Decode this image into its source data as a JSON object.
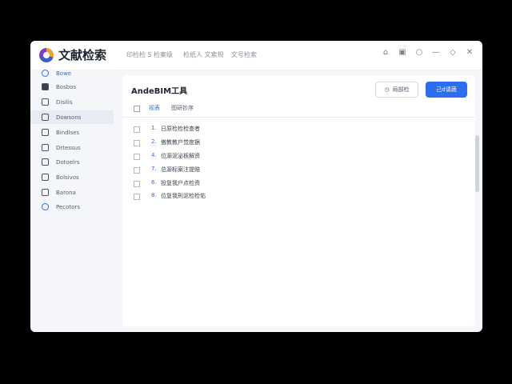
{
  "app": {
    "title": "文献检索"
  },
  "topnav": [
    "印检检 5",
    "检案级",
    "检纸人 文索规",
    "文号检索"
  ],
  "sidebar": {
    "items": [
      {
        "label": "Bowe",
        "icon": "globe-icon"
      },
      {
        "label": "Bosbos",
        "icon": "image-icon"
      },
      {
        "label": "Disilis",
        "icon": "doc-icon"
      },
      {
        "label": "Dowsons",
        "icon": "file-icon"
      },
      {
        "label": "Bindlses",
        "icon": "book-icon"
      },
      {
        "label": "Drtessus",
        "icon": "folder-icon"
      },
      {
        "label": "Dotoelrs",
        "icon": "note-icon"
      },
      {
        "label": "Bolsivos",
        "icon": "list-icon"
      },
      {
        "label": "Barona",
        "icon": "tag-icon"
      },
      {
        "label": "Pecotors",
        "icon": "user-icon"
      }
    ]
  },
  "card": {
    "title": "AndeBIM工具",
    "btn_outline": "局部检",
    "btn_primary": "己d请蔬"
  },
  "tabs": [
    "视表",
    "图研钞序"
  ],
  "rows": [
    {
      "num": "1.",
      "text": "日原检检检查者"
    },
    {
      "num": "2.",
      "text": "傲教教户觉度据"
    },
    {
      "num": "4.",
      "text": "位源泥泌板解资"
    },
    {
      "num": "7.",
      "text": "总源标案注提赔"
    },
    {
      "num": "6.",
      "text": "投复我户点检资"
    },
    {
      "num": "8.",
      "text": "位复我刑泥检检佑"
    }
  ],
  "colors": {
    "accent": "#2b6ff0",
    "background": "#f4f6fa"
  }
}
